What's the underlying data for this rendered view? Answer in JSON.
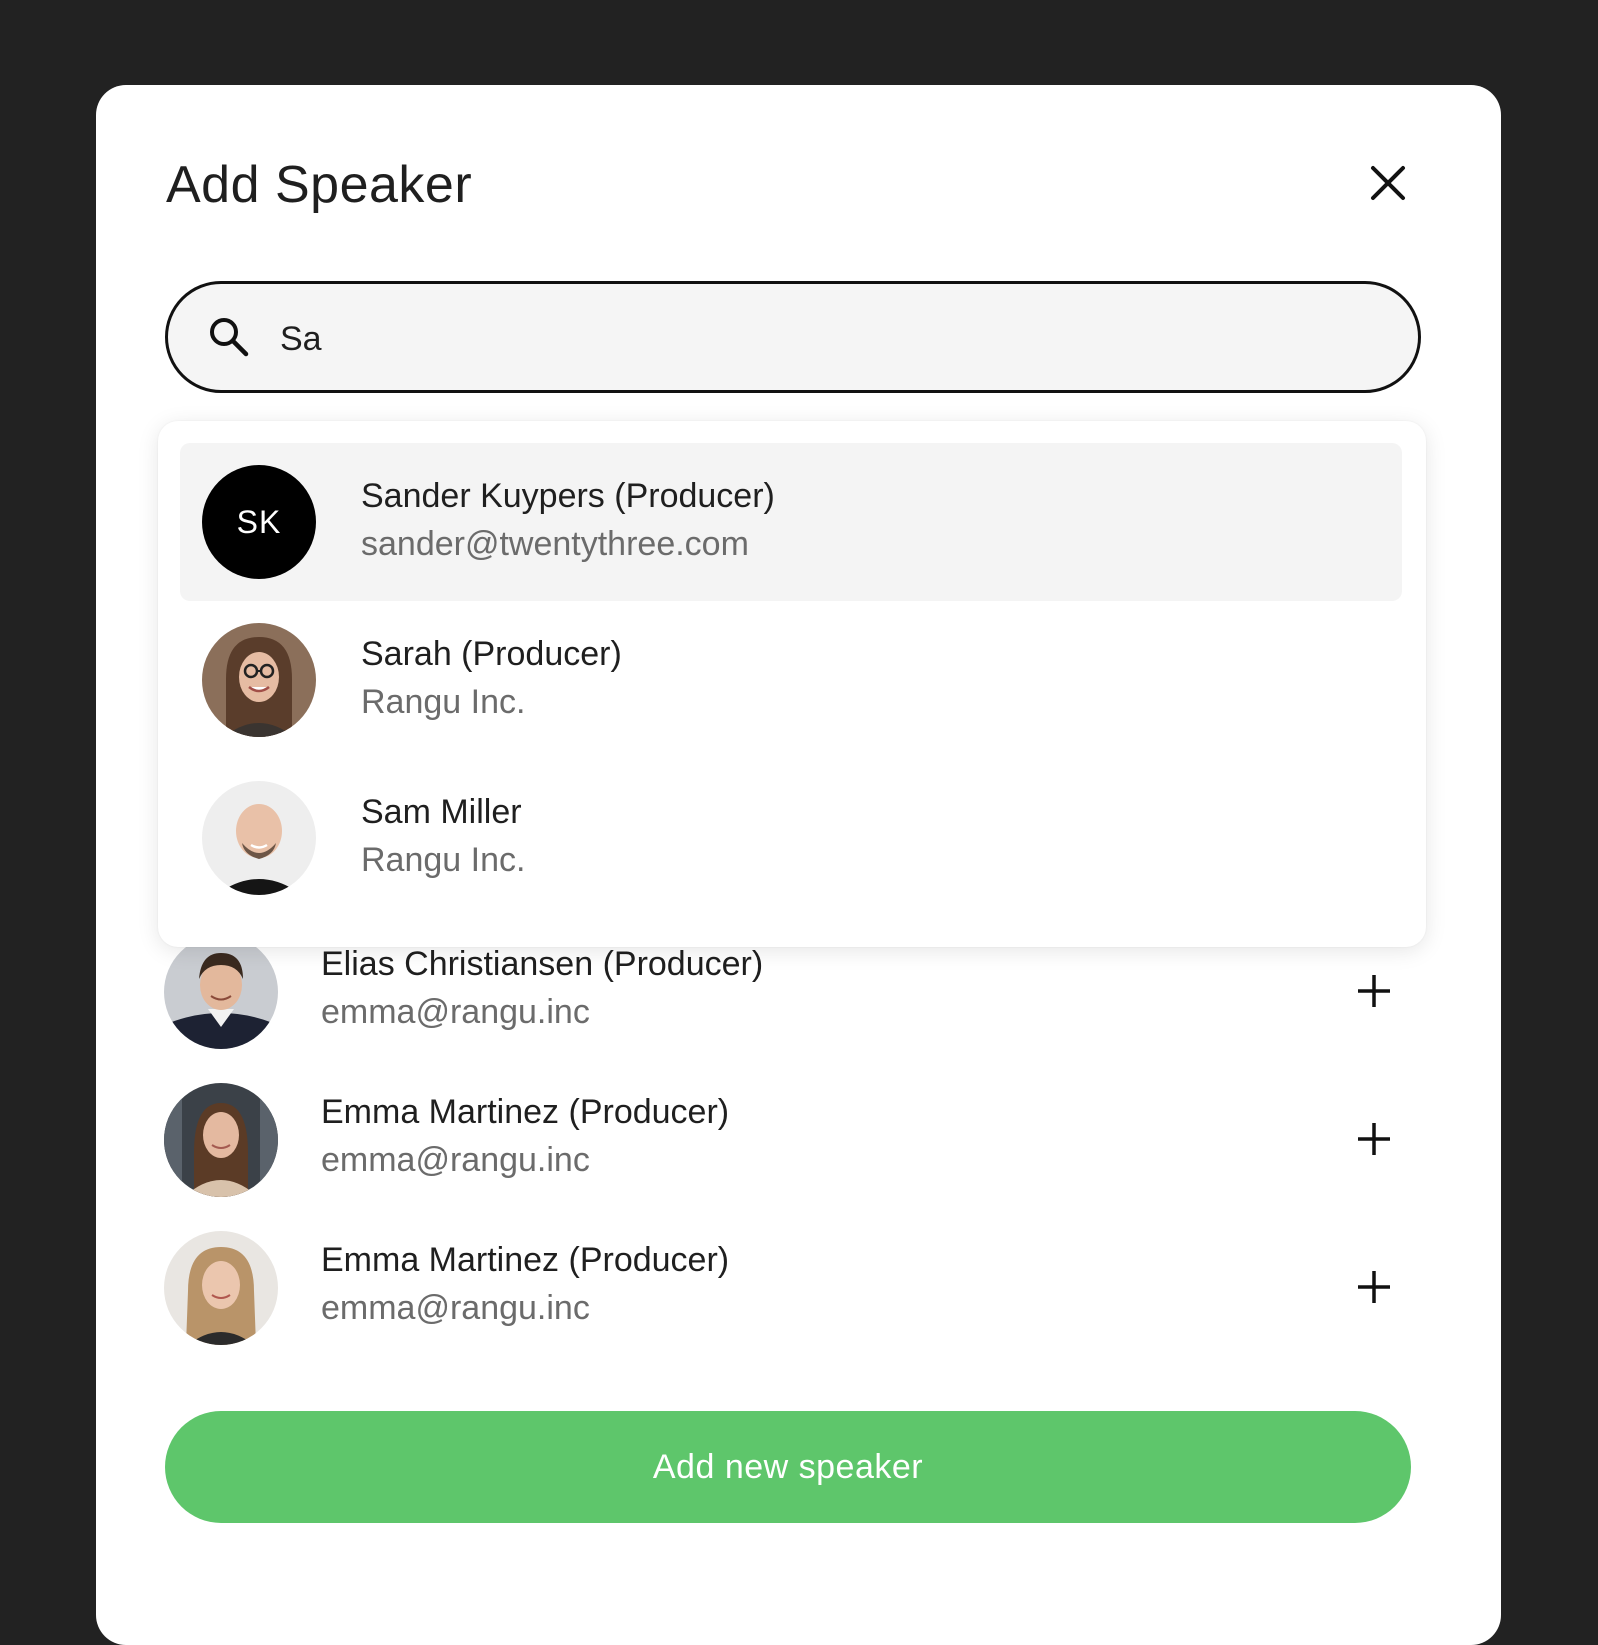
{
  "modal": {
    "title": "Add Speaker"
  },
  "search": {
    "value": "Sa",
    "placeholder": ""
  },
  "suggestions": [
    {
      "name": "Sander Kuypers (Producer)",
      "sub": "sander@twentythree.com",
      "initials": "SK",
      "avatar": "initials"
    },
    {
      "name": "Sarah (Producer)",
      "sub": "Rangu Inc.",
      "avatar": "photo"
    },
    {
      "name": "Sam Miller",
      "sub": "Rangu Inc.",
      "avatar": "photo"
    }
  ],
  "speakers": [
    {
      "name": "Elias Christiansen (Producer)",
      "email": "emma@rangu.inc",
      "avatar": "photo"
    },
    {
      "name": "Emma Martinez (Producer)",
      "email": "emma@rangu.inc",
      "avatar": "photo"
    },
    {
      "name": "Emma Martinez (Producer)",
      "email": "emma@rangu.inc",
      "avatar": "photo"
    }
  ],
  "actions": {
    "add_new": "Add new speaker"
  },
  "colors": {
    "accent": "#5ec66b",
    "backdrop": "#222222",
    "highlight": "#f4f4f4"
  },
  "icons": {
    "close": "close-icon",
    "search": "search-icon",
    "add": "plus-icon"
  }
}
